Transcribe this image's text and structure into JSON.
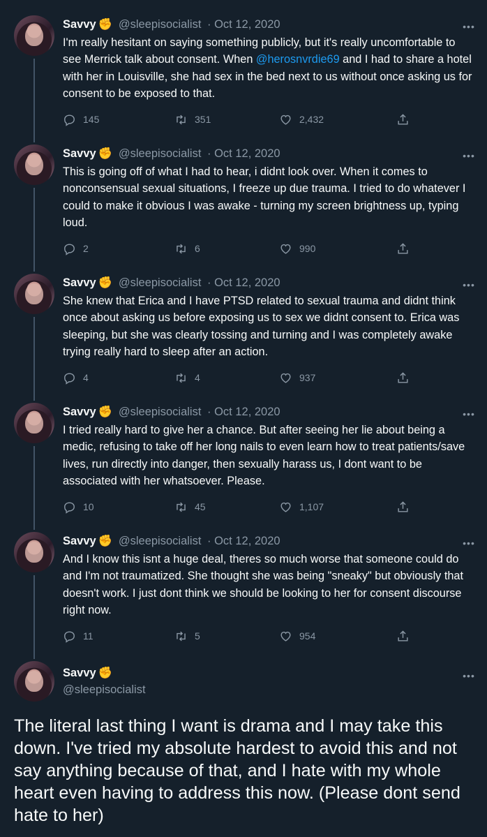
{
  "tweets": [
    {
      "name": "Savvy",
      "badge": "✊",
      "handle": "@sleepisocialist",
      "date": "Oct 12, 2020",
      "text_before": "I'm really hesitant on saying something publicly, but it's really uncomfortable to see Merrick talk about consent. When ",
      "mention": "@herosnvrdie69",
      "text_after": " and I had to share a hotel with her in Louisville, she had sex in the bed next to us without once asking us for consent to be exposed to that.",
      "replies": "145",
      "retweets": "351",
      "likes": "2,432"
    },
    {
      "name": "Savvy",
      "badge": "✊",
      "handle": "@sleepisocialist",
      "date": "Oct 12, 2020",
      "text": "This is going off of what I had to hear, i didnt look over. When it comes to nonconsensual sexual situations, I freeze up due trauma. I tried to do whatever I could to make it obvious I was awake - turning my screen brightness up, typing loud.",
      "replies": "2",
      "retweets": "6",
      "likes": "990"
    },
    {
      "name": "Savvy",
      "badge": "✊",
      "handle": "@sleepisocialist",
      "date": "Oct 12, 2020",
      "text": "She knew that Erica and I have PTSD related to sexual trauma and didnt think once about asking us before exposing us to sex we didnt consent to. Erica was sleeping, but she was clearly tossing and turning and I was completely awake  trying really hard to sleep after an action.",
      "replies": "4",
      "retweets": "4",
      "likes": "937"
    },
    {
      "name": "Savvy",
      "badge": "✊",
      "handle": "@sleepisocialist",
      "date": "Oct 12, 2020",
      "text": "I tried really hard to give her a chance. But after seeing her lie about being a medic, refusing to take off her long nails to even learn how to treat patients/save lives, run directly into danger, then sexually harass us, I dont want to be associated with her whatsoever. Please.",
      "replies": "10",
      "retweets": "45",
      "likes": "1,107"
    },
    {
      "name": "Savvy",
      "badge": "✊",
      "handle": "@sleepisocialist",
      "date": "Oct 12, 2020",
      "text": "And I know this isnt a huge deal, theres so much worse that someone could do and I'm not traumatized. She thought she was being \"sneaky\" but obviously that doesn't work. I just dont think we should be looking to her for consent discourse right now.",
      "replies": "11",
      "retweets": "5",
      "likes": "954"
    }
  ],
  "final_tweet": {
    "name": "Savvy",
    "badge": "✊",
    "handle": "@sleepisocialist",
    "text": "The literal last thing I want is drama and I may take this down. I've tried my absolute hardest to avoid this and not say anything because of that, and I hate with my whole heart even having to address this now. (Please dont send hate to her)"
  },
  "icons": [
    "reply-icon",
    "retweet-icon",
    "like-icon",
    "share-icon",
    "more-icon"
  ],
  "colors": {
    "background": "#15202b",
    "text": "#f7f9f9",
    "muted": "#8b98a5",
    "link": "#1d9bf0"
  }
}
